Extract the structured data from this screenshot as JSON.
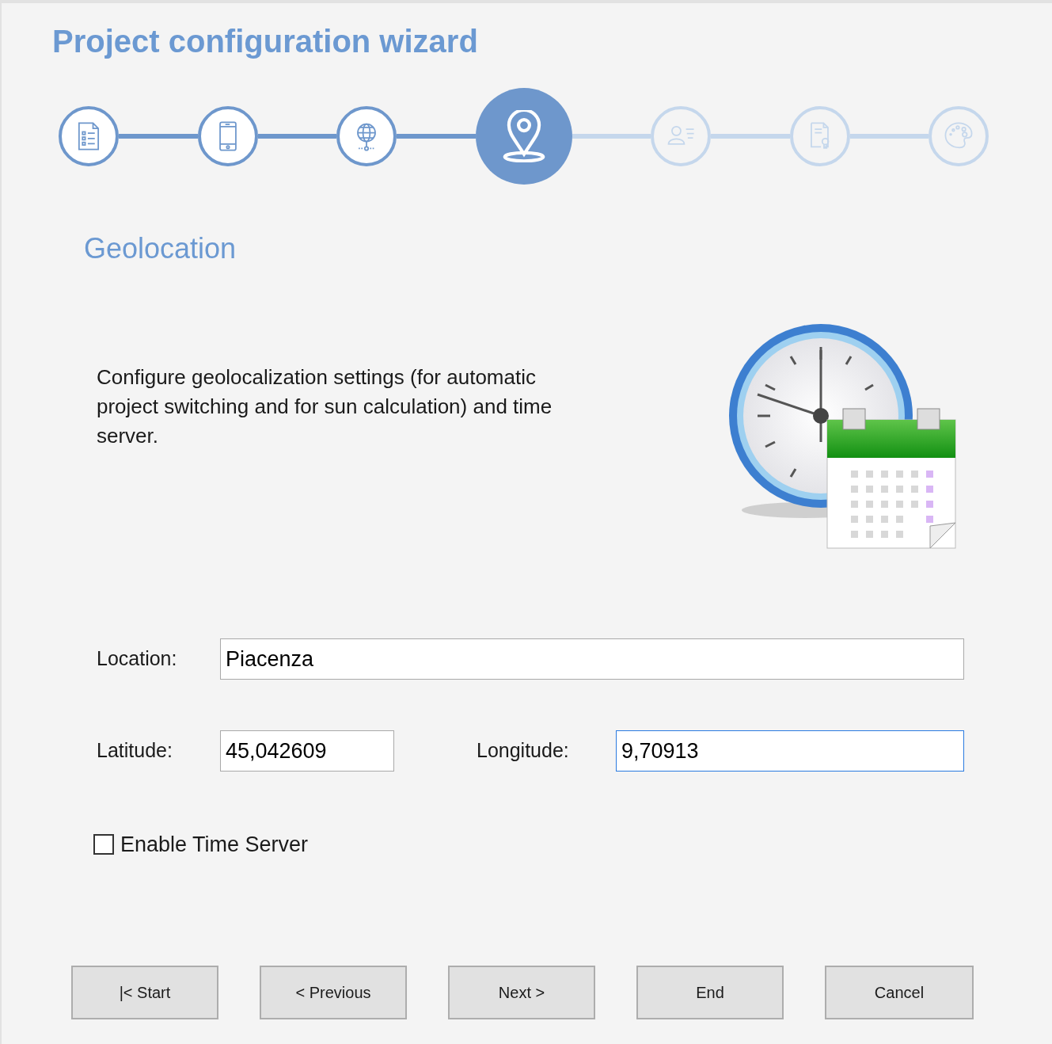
{
  "title": "Project configuration wizard",
  "steps": [
    {
      "kind": "list",
      "done": true,
      "selected": false
    },
    {
      "kind": "tablet",
      "done": true,
      "selected": false
    },
    {
      "kind": "globe",
      "done": true,
      "selected": false
    },
    {
      "kind": "pin",
      "done": true,
      "selected": true
    },
    {
      "kind": "contact",
      "done": false,
      "selected": false
    },
    {
      "kind": "certificate",
      "done": false,
      "selected": false
    },
    {
      "kind": "palette",
      "done": false,
      "selected": false
    }
  ],
  "section_title": "Geolocation",
  "description": "Configure geolocalization settings (for automatic project switching and for sun calculation) and time server.",
  "location": {
    "label": "Location:",
    "value": "Piacenza",
    "focused": false
  },
  "latitude": {
    "label": "Latitude:",
    "value": "45,042609",
    "focused": false
  },
  "longitude": {
    "label": "Longitude:",
    "value": "9,70913",
    "focused": true
  },
  "time_server": {
    "label": "Enable Time Server",
    "checked": false
  },
  "buttons": [
    "|< Start",
    "< Previous",
    "Next >",
    "End",
    "Cancel"
  ]
}
